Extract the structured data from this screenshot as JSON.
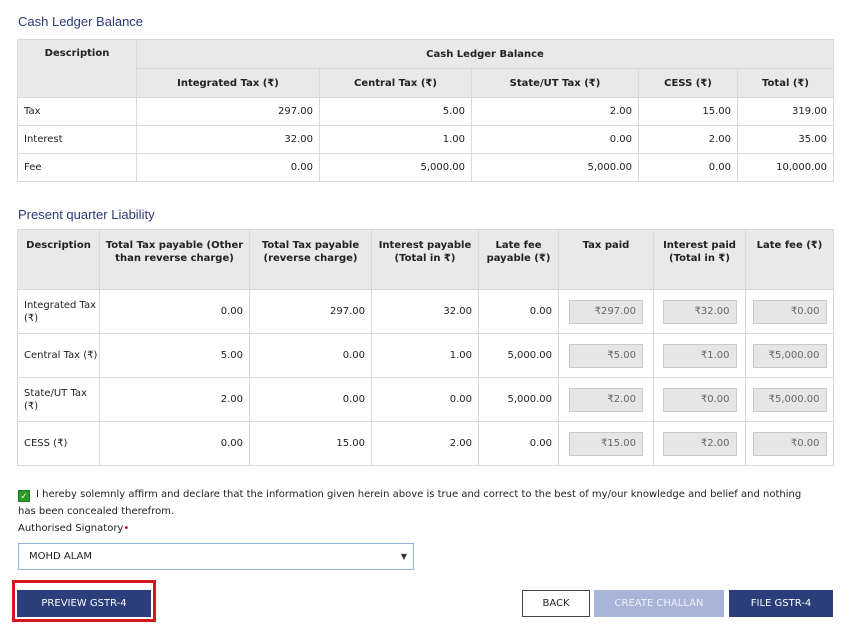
{
  "ledger": {
    "title": "Cash Ledger Balance",
    "group_header": "Cash Ledger Balance",
    "desc_header": "Description",
    "columns": [
      "Integrated Tax (₹)",
      "Central Tax (₹)",
      "State/UT Tax (₹)",
      "CESS (₹)",
      "Total (₹)"
    ],
    "rows": [
      {
        "label": "Tax",
        "values": [
          "297.00",
          "5.00",
          "2.00",
          "15.00",
          "319.00"
        ]
      },
      {
        "label": "Interest",
        "values": [
          "32.00",
          "1.00",
          "0.00",
          "2.00",
          "35.00"
        ]
      },
      {
        "label": "Fee",
        "values": [
          "0.00",
          "5,000.00",
          "5,000.00",
          "0.00",
          "10,000.00"
        ]
      }
    ]
  },
  "liability": {
    "title": "Present quarter Liability",
    "columns": [
      "Description",
      "Total Tax payable (Other than reverse charge)",
      "Total Tax payable (reverse charge)",
      "Interest payable (Total in ₹)",
      "Late fee payable (₹)",
      "Tax paid",
      "Interest paid (Total in ₹)",
      "Late fee (₹)"
    ],
    "rows": [
      {
        "label": "Integrated Tax (₹)",
        "values": [
          "0.00",
          "297.00",
          "32.00",
          "0.00"
        ],
        "paid": [
          "₹297.00",
          "₹32.00",
          "₹0.00"
        ]
      },
      {
        "label": "Central Tax (₹)",
        "values": [
          "5.00",
          "0.00",
          "1.00",
          "5,000.00"
        ],
        "paid": [
          "₹5.00",
          "₹1.00",
          "₹5,000.00"
        ]
      },
      {
        "label": "State/UT Tax (₹)",
        "values": [
          "2.00",
          "0.00",
          "0.00",
          "5,000.00"
        ],
        "paid": [
          "₹2.00",
          "₹0.00",
          "₹5,000.00"
        ]
      },
      {
        "label": "CESS (₹)",
        "values": [
          "0.00",
          "15.00",
          "2.00",
          "0.00"
        ],
        "paid": [
          "₹15.00",
          "₹2.00",
          "₹0.00"
        ]
      }
    ]
  },
  "declaration": {
    "checked": true,
    "text": "I hereby solemnly affirm and declare that the information given herein above is true and correct to the best of my/our knowledge and belief and nothing has been concealed therefrom."
  },
  "signatory": {
    "label": "Authorised Signatory",
    "required_mark": "•",
    "selected": "MOHD ALAM"
  },
  "buttons": {
    "preview": "PREVIEW GSTR-4",
    "back": "BACK",
    "create_challan": "CREATE CHALLAN",
    "file": "FILE GSTR-4"
  },
  "colors": {
    "primary": "#2b3d7a",
    "highlight": "#d8161e",
    "title": "#2c3a78"
  }
}
